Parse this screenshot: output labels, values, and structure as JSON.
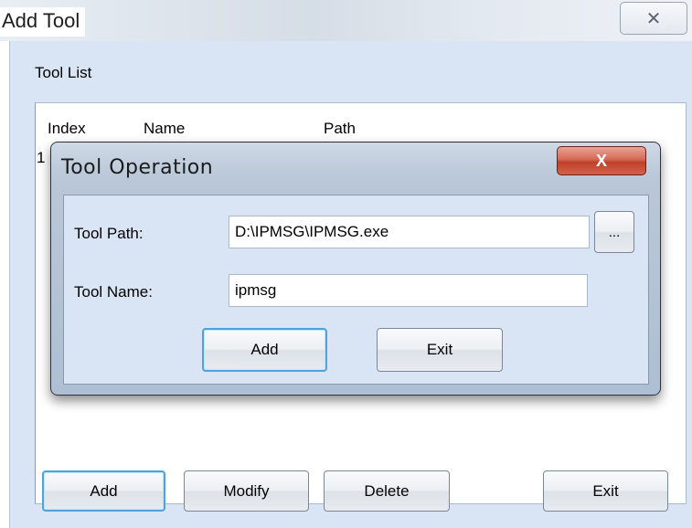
{
  "window": {
    "title": "Add Tool",
    "close_glyph": "✕"
  },
  "tool_list": {
    "label": "Tool List",
    "columns": [
      "Index",
      "Name",
      "Path"
    ],
    "first_row_index_fragment": "1"
  },
  "bottom_buttons": {
    "add": "Add",
    "modify": "Modify",
    "delete": "Delete",
    "exit": "Exit"
  },
  "dialog": {
    "title": "Tool Operation",
    "close_glyph": "X",
    "tool_path_label": "Tool Path:",
    "tool_path_value": "D:\\IPMSG\\IPMSG.exe",
    "browse_label": "...",
    "tool_name_label": "Tool Name:",
    "tool_name_value": "ipmsg",
    "add_label": "Add",
    "exit_label": "Exit"
  },
  "colors": {
    "client_bg": "#d9e5f5",
    "dialog_close_red": "#c0402a",
    "focus_blue": "#4fa3dc"
  }
}
